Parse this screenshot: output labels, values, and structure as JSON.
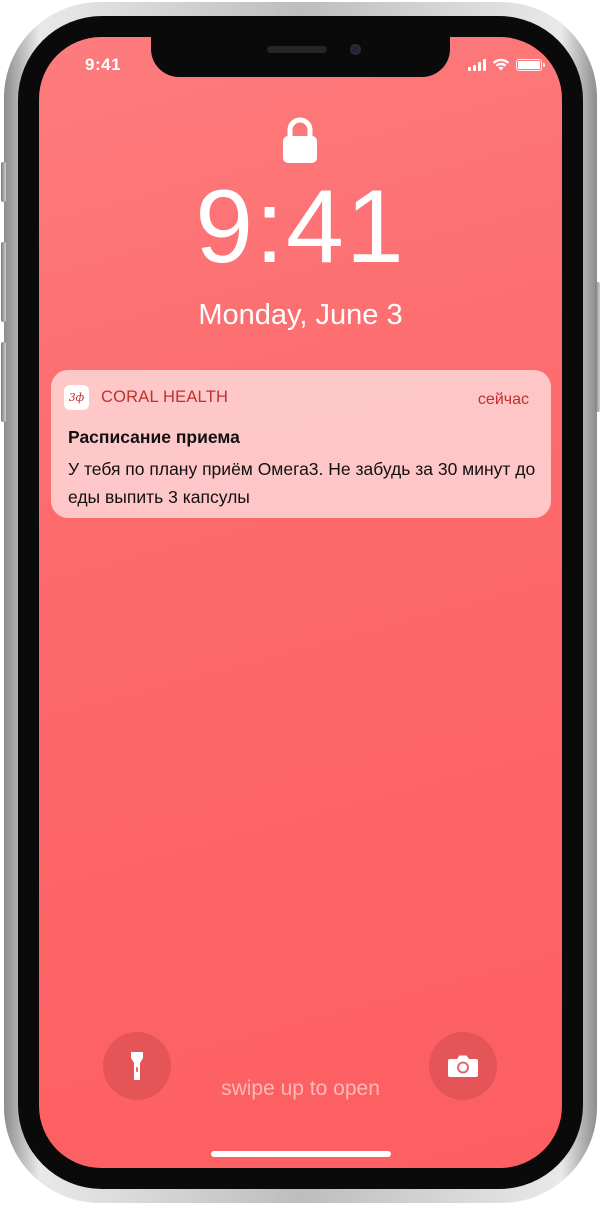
{
  "status_bar": {
    "time": "9:41",
    "icons": [
      "signal-icon",
      "wifi-icon",
      "battery-icon"
    ]
  },
  "lock_screen": {
    "lock_icon": "lock-icon",
    "time": "9:41",
    "date": "Monday, June 3"
  },
  "notification": {
    "app_name": "CORAL HEALTH",
    "app_icon_text": "3ф",
    "timestamp": "сейчас",
    "title": "Расписание приема",
    "body": "У тебя по плану приём Омега3. Не забудь за 30 минут до еды выпить 3 капсулы",
    "accent_color": "#c0302f"
  },
  "bottom": {
    "left_button": "flashlight-icon",
    "right_button": "camera-icon",
    "hint": "swipe up to open"
  },
  "colors": {
    "background_top": "#fd7c7e",
    "background_bottom": "#fd5e61",
    "notification_text": "#111111"
  }
}
